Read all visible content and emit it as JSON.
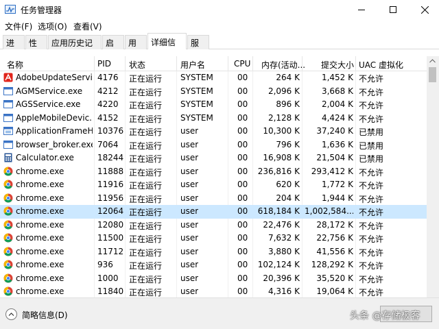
{
  "window": {
    "title": "任务管理器",
    "app_icon": "task-manager-icon",
    "controls": [
      "minimize-icon",
      "maximize-icon",
      "close-icon"
    ]
  },
  "menu": [
    {
      "label": "文件(F)"
    },
    {
      "label": "选项(O)"
    },
    {
      "label": "查看(V)"
    }
  ],
  "tabs": [
    {
      "label": "进程"
    },
    {
      "label": "性能"
    },
    {
      "label": "应用历史记录"
    },
    {
      "label": "启动"
    },
    {
      "label": "用户"
    },
    {
      "label": "详细信息",
      "active": true
    },
    {
      "label": "服务"
    }
  ],
  "columns": [
    "名称",
    "PID",
    "状态",
    "用户名",
    "CPU",
    "内存(活动...",
    "提交大小",
    "UAC 虚拟化"
  ],
  "rows": [
    {
      "icon": "adobe-icon",
      "name": "AdobeUpdateServi...",
      "pid": "4176",
      "status": "正在运行",
      "user": "SYSTEM",
      "cpu": "00",
      "mem": "264 K",
      "commit": "1,452 K",
      "uac": "不允许"
    },
    {
      "icon": "service-exe-icon",
      "name": "AGMService.exe",
      "pid": "4212",
      "status": "正在运行",
      "user": "SYSTEM",
      "cpu": "00",
      "mem": "2,096 K",
      "commit": "3,668 K",
      "uac": "不允许"
    },
    {
      "icon": "service-exe-icon",
      "name": "AGSService.exe",
      "pid": "4220",
      "status": "正在运行",
      "user": "SYSTEM",
      "cpu": "00",
      "mem": "896 K",
      "commit": "2,004 K",
      "uac": "不允许"
    },
    {
      "icon": "service-exe-icon",
      "name": "AppleMobileDevic...",
      "pid": "4152",
      "status": "正在运行",
      "user": "SYSTEM",
      "cpu": "00",
      "mem": "2,128 K",
      "commit": "4,424 K",
      "uac": "不允许"
    },
    {
      "icon": "app-window-icon",
      "name": "ApplicationFrameH...",
      "pid": "10376",
      "status": "正在运行",
      "user": "user",
      "cpu": "00",
      "mem": "10,300 K",
      "commit": "37,240 K",
      "uac": "已禁用"
    },
    {
      "icon": "service-exe-icon",
      "name": "browser_broker.exe",
      "pid": "7064",
      "status": "正在运行",
      "user": "user",
      "cpu": "00",
      "mem": "796 K",
      "commit": "1,636 K",
      "uac": "已禁用"
    },
    {
      "icon": "calculator-icon",
      "name": "Calculator.exe",
      "pid": "18244",
      "status": "正在运行",
      "user": "user",
      "cpu": "00",
      "mem": "16,908 K",
      "commit": "21,504 K",
      "uac": "已禁用"
    },
    {
      "icon": "chrome-icon",
      "name": "chrome.exe",
      "pid": "11888",
      "status": "正在运行",
      "user": "user",
      "cpu": "00",
      "mem": "236,816 K",
      "commit": "293,412 K",
      "uac": "不允许"
    },
    {
      "icon": "chrome-icon",
      "name": "chrome.exe",
      "pid": "11916",
      "status": "正在运行",
      "user": "user",
      "cpu": "00",
      "mem": "620 K",
      "commit": "1,772 K",
      "uac": "不允许"
    },
    {
      "icon": "chrome-icon",
      "name": "chrome.exe",
      "pid": "11956",
      "status": "正在运行",
      "user": "user",
      "cpu": "00",
      "mem": "204 K",
      "commit": "1,944 K",
      "uac": "不允许"
    },
    {
      "icon": "chrome-icon",
      "name": "chrome.exe",
      "pid": "12064",
      "status": "正在运行",
      "user": "user",
      "cpu": "00",
      "mem": "618,184 K",
      "commit": "1,002,584...",
      "uac": "不允许",
      "selected": true
    },
    {
      "icon": "chrome-icon",
      "name": "chrome.exe",
      "pid": "12080",
      "status": "正在运行",
      "user": "user",
      "cpu": "00",
      "mem": "22,476 K",
      "commit": "28,172 K",
      "uac": "不允许"
    },
    {
      "icon": "chrome-icon",
      "name": "chrome.exe",
      "pid": "11500",
      "status": "正在运行",
      "user": "user",
      "cpu": "00",
      "mem": "7,632 K",
      "commit": "22,756 K",
      "uac": "不允许"
    },
    {
      "icon": "chrome-icon",
      "name": "chrome.exe",
      "pid": "11712",
      "status": "正在运行",
      "user": "user",
      "cpu": "00",
      "mem": "3,880 K",
      "commit": "41,556 K",
      "uac": "不允许"
    },
    {
      "icon": "chrome-icon",
      "name": "chrome.exe",
      "pid": "936",
      "status": "正在运行",
      "user": "user",
      "cpu": "00",
      "mem": "102,124 K",
      "commit": "128,292 K",
      "uac": "不允许"
    },
    {
      "icon": "chrome-icon",
      "name": "chrome.exe",
      "pid": "1000",
      "status": "正在运行",
      "user": "user",
      "cpu": "00",
      "mem": "20,396 K",
      "commit": "35,520 K",
      "uac": "不允许"
    },
    {
      "icon": "chrome-icon",
      "name": "chrome.exe",
      "pid": "11840",
      "status": "正在运行",
      "user": "user",
      "cpu": "00",
      "mem": "4,316 K",
      "commit": "19,064 K",
      "uac": "不允许"
    }
  ],
  "footer": {
    "collapse_label": "简略信息(D)",
    "watermark": "头条 @存储极客"
  },
  "colors": {
    "selected_row": "#cce8ff",
    "chrome_red": "#db4437",
    "chrome_green": "#0f9d58",
    "chrome_yellow": "#f4b400",
    "chrome_blue": "#4285f4",
    "adobe_red": "#e0241b"
  }
}
